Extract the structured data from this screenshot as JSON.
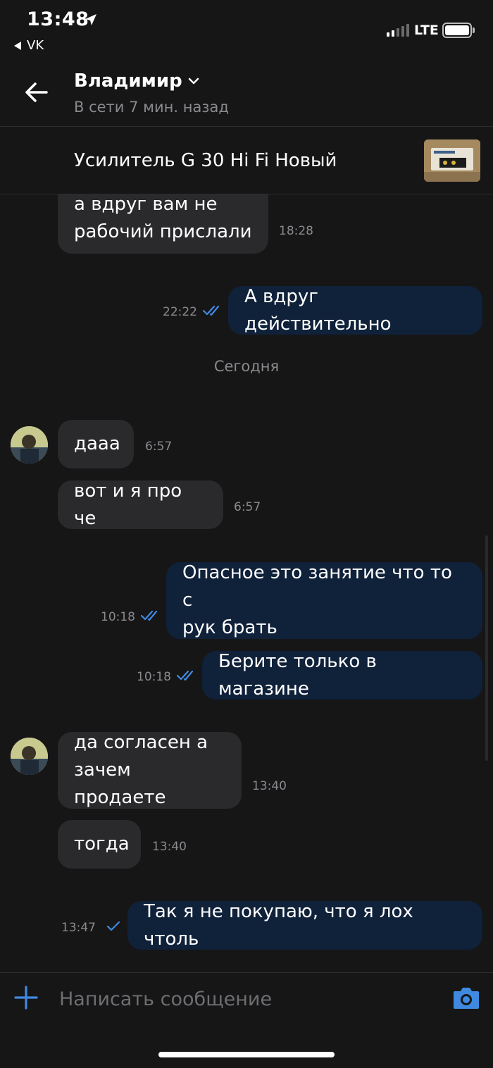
{
  "status_bar": {
    "time": "13:48",
    "back_app": "VK",
    "network": "LTE"
  },
  "header": {
    "contact_name": "Владимир",
    "contact_status": "В сети 7 мин. назад"
  },
  "listing": {
    "title": "Усилитель G 30 Hi Fi Новый"
  },
  "chat": {
    "date_separator": "Сегодня",
    "messages": [
      {
        "direction": "in",
        "lines": [
          "а вдруг вам не",
          "рабочий прислали"
        ],
        "time": "18:28"
      },
      {
        "direction": "out",
        "lines": [
          "А вдруг действительно"
        ],
        "time": "22:22",
        "status": "read"
      },
      {
        "direction": "in",
        "lines": [
          "дааа"
        ],
        "time": "6:57"
      },
      {
        "direction": "in",
        "lines": [
          "вот и я про че"
        ],
        "time": "6:57"
      },
      {
        "direction": "out",
        "lines": [
          "Опасное это занятие что то с",
          "рук брать"
        ],
        "time": "10:18",
        "status": "read"
      },
      {
        "direction": "out",
        "lines": [
          "Берите только в магазине"
        ],
        "time": "10:18",
        "status": "read"
      },
      {
        "direction": "in",
        "lines": [
          "да согласен а",
          "зачем продаете"
        ],
        "time": "13:40"
      },
      {
        "direction": "in",
        "lines": [
          "тогда"
        ],
        "time": "13:40"
      },
      {
        "direction": "out",
        "lines": [
          "Так я не покупаю, что я лох чтоль"
        ],
        "time": "13:47",
        "status": "sent"
      }
    ]
  },
  "composer": {
    "placeholder": "Написать сообщение"
  },
  "colors": {
    "background": "#161617",
    "incoming_bubble": "#2a2a2c",
    "outgoing_bubble": "#10213a",
    "accent": "#3f8ae0",
    "secondary_text": "#8a8a8e"
  },
  "icons": [
    "back-arrow-icon",
    "chevron-down-icon",
    "plus-icon",
    "camera-icon",
    "double-check-icon",
    "single-check-icon",
    "location-arrow-icon"
  ]
}
